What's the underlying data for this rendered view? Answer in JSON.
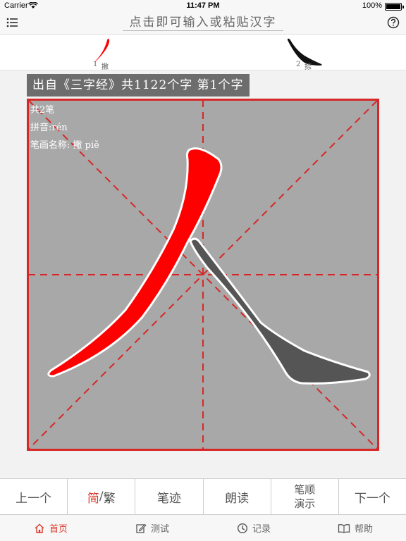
{
  "status_bar": {
    "carrier": "Carrier",
    "time": "11:47 PM",
    "battery": "100%",
    "battery_level": 1.0
  },
  "nav": {
    "search_placeholder": "点击即可输入或粘贴汉字",
    "menu_icon": "list-icon",
    "help_icon": "question-icon"
  },
  "strokes": [
    {
      "number": "1",
      "name": "撇"
    },
    {
      "number": "2",
      "name": "捺"
    }
  ],
  "source": {
    "text": "出自《三字经》共1122个字 第1个字"
  },
  "character": {
    "glyph": "人",
    "stroke_count": "共2笔",
    "pinyin": "拼音:rén",
    "stroke_name": "笔画名称: 撇 piě"
  },
  "toolbar": {
    "prev": "上一个",
    "simplified": "简",
    "separator": "/",
    "traditional": "繁",
    "trace": "笔迹",
    "read": "朗读",
    "order_line1": "笔顺",
    "order_line2": "演示",
    "next": "下一个"
  },
  "tabs": [
    {
      "label": "首页",
      "icon": "home-icon"
    },
    {
      "label": "测试",
      "icon": "edit-icon"
    },
    {
      "label": "记录",
      "icon": "clock-icon"
    },
    {
      "label": "帮助",
      "icon": "book-icon"
    }
  ],
  "colors": {
    "accent": "#d9372b",
    "grid": "#d62828",
    "active_stroke": "#ff0000",
    "pending_stroke": "#555555",
    "cell_bg": "#a8a8a8"
  }
}
